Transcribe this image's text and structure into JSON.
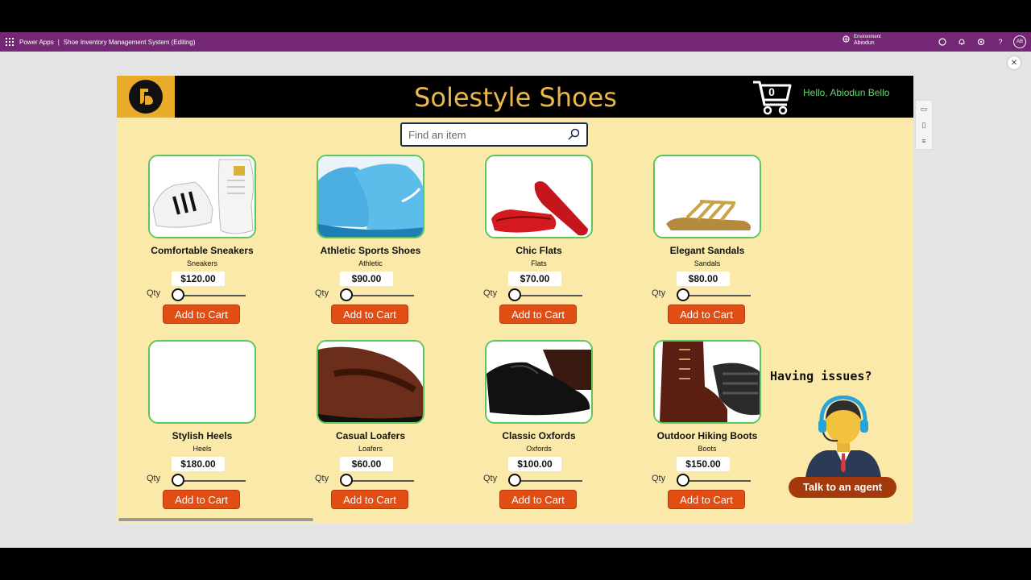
{
  "header": {
    "app_name": "Power Apps",
    "separator": "|",
    "app_title": "Shoe Inventory Management System (Editing)",
    "environment_label": "Environment",
    "environment_value": "Abiodun",
    "avatar_initials": "AB"
  },
  "app": {
    "brand": "Solestyle Shoes",
    "cart_count": "0",
    "greeting": "Hello, Abiodun Bello",
    "search_placeholder": "Find an item"
  },
  "products": [
    {
      "name": "Comfortable Sneakers",
      "category": "Sneakers",
      "price": "$120.00",
      "qty_label": "Qty",
      "qty": 0,
      "button": "Add to Cart",
      "image": "sneakers-image"
    },
    {
      "name": "Athletic Sports Shoes",
      "category": "Athletic",
      "price": "$90.00",
      "qty_label": "Qty",
      "qty": 0,
      "button": "Add to Cart",
      "image": "athletic-shoes-image"
    },
    {
      "name": "Chic Flats",
      "category": "Flats",
      "price": "$70.00",
      "qty_label": "Qty",
      "qty": 0,
      "button": "Add to Cart",
      "image": "flats-image"
    },
    {
      "name": "Elegant Sandals",
      "category": "Sandals",
      "price": "$80.00",
      "qty_label": "Qty",
      "qty": 0,
      "button": "Add to Cart",
      "image": "sandals-image"
    },
    {
      "name": "Stylish Heels",
      "category": "Heels",
      "price": "$180.00",
      "qty_label": "Qty",
      "qty": 0,
      "button": "Add to Cart",
      "image": "heels-image-blank"
    },
    {
      "name": "Casual Loafers",
      "category": "Loafers",
      "price": "$60.00",
      "qty_label": "Qty",
      "qty": 0,
      "button": "Add to Cart",
      "image": "loafers-image"
    },
    {
      "name": "Classic Oxfords",
      "category": "Oxfords",
      "price": "$100.00",
      "qty_label": "Qty",
      "qty": 0,
      "button": "Add to Cart",
      "image": "oxfords-image"
    },
    {
      "name": "Outdoor Hiking Boots",
      "category": "Boots",
      "price": "$150.00",
      "qty_label": "Qty",
      "qty": 0,
      "button": "Add to Cart",
      "image": "boots-image"
    }
  ],
  "support": {
    "prompt": "Having issues?",
    "button": "Talk to an agent"
  },
  "colors": {
    "header_purple": "#742774",
    "canvas_bg": "#fbe9a9",
    "brand_gold": "#e8b84a",
    "greeting_green": "#66d66a",
    "button_orange": "#e14d12",
    "card_border": "#5cc65c"
  }
}
